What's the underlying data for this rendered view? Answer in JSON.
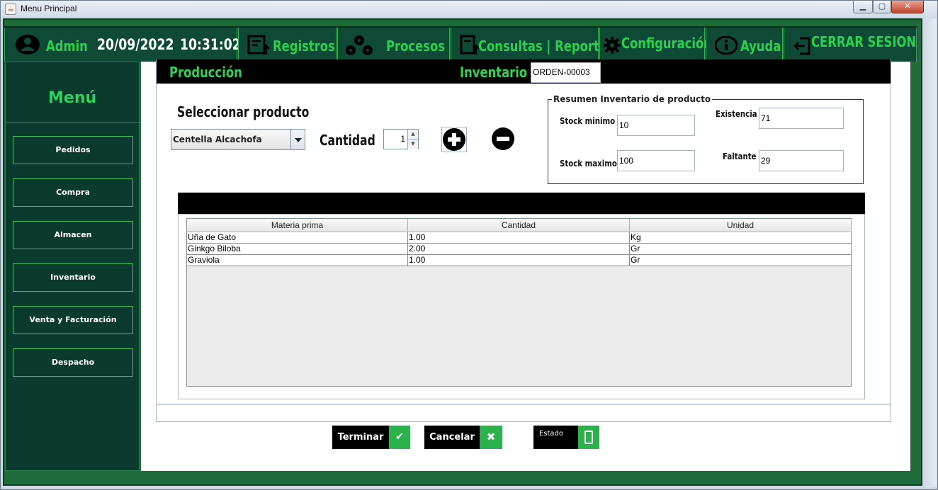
{
  "window": {
    "title": "Menu Principal",
    "min_glyph": "▁",
    "max_glyph": "▢",
    "close_glyph": "✕"
  },
  "menubar": {
    "user": "Admin",
    "date": "20/09/2022",
    "time": "10:31:02",
    "registros": "Registros",
    "procesos": "Procesos",
    "consultas": "Consultas | Reportes",
    "configuracion": "Configuración",
    "ayuda": "Ayuda",
    "cerrar": "CERRAR SESION"
  },
  "sidebar": {
    "title": "Menú",
    "items": [
      {
        "label": "Pedidos"
      },
      {
        "label": "Compra"
      },
      {
        "label": "Almacen"
      },
      {
        "label": "Inventario"
      },
      {
        "label": "Venta y Facturación"
      },
      {
        "label": "Despacho"
      }
    ]
  },
  "header": {
    "produccion": "Producción",
    "inventario": "Inventario",
    "orden": "ORDEN-00003"
  },
  "product": {
    "select_label": "Seleccionar producto",
    "selected": "Centella Alcachofa",
    "cantidad_label": "Cantidad",
    "cantidad": "1",
    "spin_up": "▲",
    "spin_down": "▼"
  },
  "resumen": {
    "title": "Resumen Inventario de producto",
    "stock_min_label": "Stock minimo",
    "stock_min": "10",
    "stock_max_label": "Stock maximo",
    "stock_max": "100",
    "existencia_label": "Existencia",
    "existencia": "71",
    "faltante_label": "Faltante",
    "faltante": "29"
  },
  "table": {
    "headers": [
      "Materia prima",
      "Cantidad",
      "Unidad"
    ],
    "rows": [
      [
        "Uña de Gato",
        "1.00",
        "Kg"
      ],
      [
        "Ginkgo Biloba",
        "2.00",
        "Gr"
      ],
      [
        "Graviola",
        "1.00",
        "Gr"
      ]
    ]
  },
  "actions": {
    "terminar": "Terminar",
    "terminar_icon": "✔",
    "cancelar": "Cancelar",
    "cancelar_icon": "✖",
    "estado": "Estado"
  },
  "colors": {
    "accent": "#2fd35a",
    "menubar": "#0e4a36",
    "sidebar": "#0b3b2e",
    "frame": "#1f6b3a"
  }
}
